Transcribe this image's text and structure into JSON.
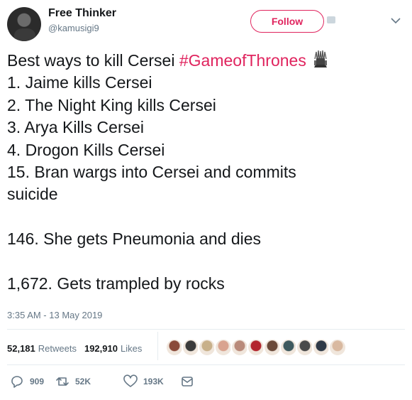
{
  "user": {
    "name": "Free Thinker",
    "handle": "@kamusigi9"
  },
  "header": {
    "follow_label": "Follow"
  },
  "tweet": {
    "lines": [
      "Best ways to kill Cersei ",
      "1. Jaime kills Cersei",
      "2. The Night King kills Cersei",
      "3. Arya Kills Cersei",
      "4. Drogon Kills Cersei",
      "15. Bran wargs into Cersei and commits",
      "suicide",
      "146. She gets Pneumonia and dies",
      "1,672. Gets trampled by rocks"
    ],
    "hashtag": "#GameofThrones",
    "hashtag_emoji": "iron-throne-icon",
    "timestamp": "3:35 AM - 13 May 2019"
  },
  "stats": {
    "retweets_count": "52,181",
    "retweets_label": "Retweets",
    "likes_count": "192,910",
    "likes_label": "Likes",
    "liker_avatar_colors": [
      "#8a4b3a",
      "#3b3b3b",
      "#c8b08a",
      "#d9a38f",
      "#b98a7a",
      "#b3262e",
      "#6b4a3a",
      "#3f5a5f",
      "#4a4a4a",
      "#2f3a48",
      "#d9b9a0"
    ]
  },
  "actions": {
    "reply_count": "909",
    "retweet_count": "52K",
    "like_count": "193K"
  },
  "colors": {
    "accent": "#e0245e",
    "secondary_text": "#657786",
    "primary_text": "#14171a",
    "divider": "#e6ecf0"
  }
}
